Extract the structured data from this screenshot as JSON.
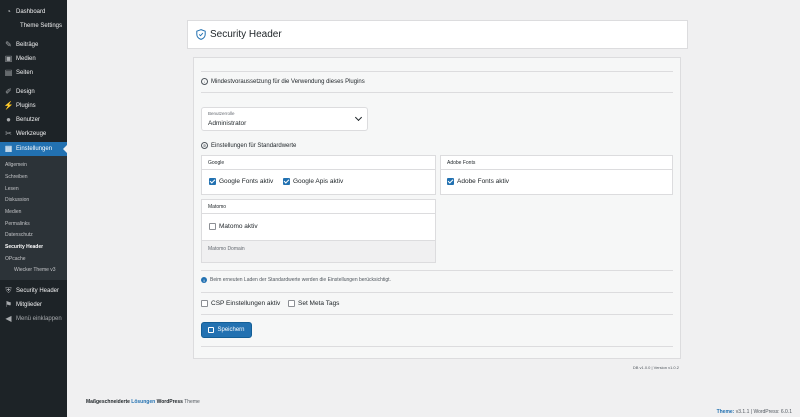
{
  "sidebar": {
    "top_items": [
      {
        "label": "Dashboard",
        "icon": "dashboard-icon"
      },
      {
        "label": "Theme Settings",
        "icon": ""
      }
    ],
    "items": [
      {
        "label": "Beiträge",
        "icon": "pin-icon"
      },
      {
        "label": "Medien",
        "icon": "media-icon"
      },
      {
        "label": "Seiten",
        "icon": "pages-icon"
      },
      {
        "label": "Design",
        "icon": "brush-icon"
      },
      {
        "label": "Plugins",
        "icon": "plugin-icon"
      },
      {
        "label": "Benutzer",
        "icon": "user-icon"
      },
      {
        "label": "Werkzeuge",
        "icon": "wrench-icon"
      },
      {
        "label": "Einstellungen",
        "icon": "settings-icon"
      }
    ],
    "submenu": [
      {
        "label": "Allgemein"
      },
      {
        "label": "Schreiben"
      },
      {
        "label": "Lesen"
      },
      {
        "label": "Diskussion"
      },
      {
        "label": "Medien"
      },
      {
        "label": "Permalinks"
      },
      {
        "label": "Datenschutz"
      },
      {
        "label": "Security Header"
      },
      {
        "label": "OPcache"
      },
      {
        "label": "Wiecker Theme v3"
      }
    ],
    "bottom_items": [
      {
        "label": "Security Header",
        "icon": "shield-icon"
      },
      {
        "label": "Mitglieder",
        "icon": "members-icon"
      },
      {
        "label": "Menü einklappen",
        "icon": "collapse-icon"
      }
    ]
  },
  "header": {
    "title": "Security Header"
  },
  "main": {
    "requirement_label": "Mindestvoraussetzung für die Verwendung dieses Plugins",
    "role_select": {
      "caption": "Benutzerrolle",
      "value": "Administrator"
    },
    "defaults_label": "Einstellungen für Standardwerte",
    "google": {
      "title": "Google",
      "options": [
        {
          "label": "Google Fonts aktiv",
          "checked": true
        },
        {
          "label": "Google Apis aktiv",
          "checked": true
        }
      ]
    },
    "adobe": {
      "title": "Adobe Fonts",
      "options": [
        {
          "label": "Adobe Fonts aktiv",
          "checked": true
        }
      ]
    },
    "matomo": {
      "title": "Matomo",
      "options": [
        {
          "label": "Matomo aktiv",
          "checked": false
        }
      ],
      "domain_placeholder": "Matomo Domain"
    },
    "info_text": "Beim erneuten Laden der Standardwerte werden die Einstellungen berücksichtigt.",
    "csp": {
      "label": "CSP Einstellungen aktiv",
      "checked": false
    },
    "meta": {
      "label": "Set Meta Tags",
      "checked": false
    },
    "save_label": "Speichern",
    "version": "DB v1.0.0 | Version v1.0.2"
  },
  "footer": {
    "left_a": "Maßgeschneiderte",
    "left_b": "Lösungen",
    "left_c": "WordPress",
    "left_d": "Theme",
    "right_a": "Theme:",
    "right_b": "v3.1.1",
    "right_c": "| WordPress:",
    "right_d": "6.0.1"
  },
  "colors": {
    "accent": "#2271b1",
    "sidebar": "#1d2327"
  }
}
